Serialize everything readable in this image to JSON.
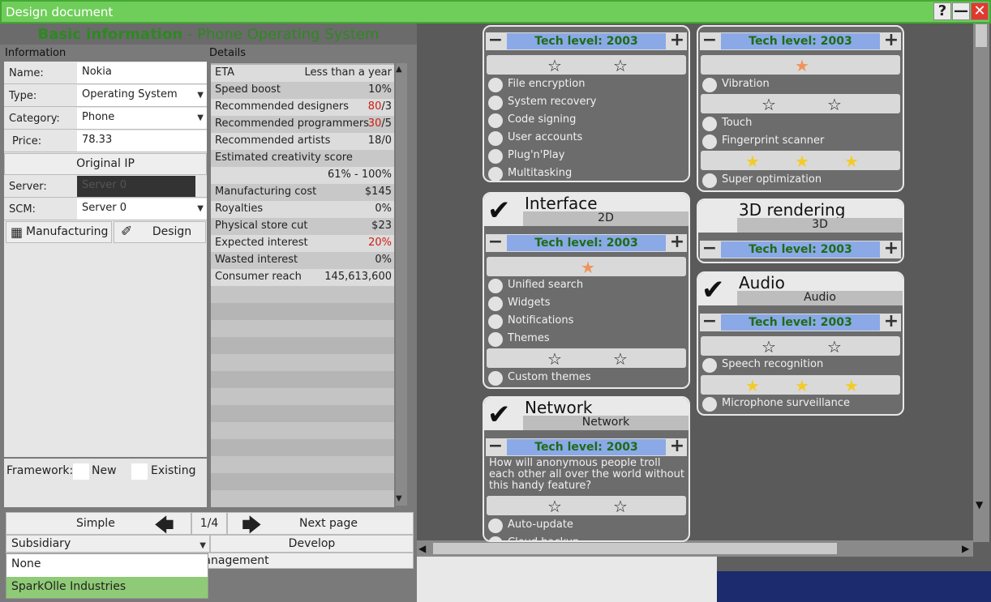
{
  "window": {
    "title": "Design document",
    "help": "?",
    "minimize": "—",
    "close": "✕"
  },
  "heading": {
    "main": "Basic information",
    "sep": " - ",
    "sub": "Phone Operating System"
  },
  "info": {
    "section": "Information",
    "name_label": "Name:",
    "name": "Nokia",
    "type_label": "Type:",
    "type": "Operating System",
    "category_label": "Category:",
    "category": "Phone",
    "price_label": "Price:",
    "price": "78.33",
    "original_ip": "Original IP",
    "server_label": "Server:",
    "server": "Server 0",
    "scm_label": "SCM:",
    "scm": "Server 0",
    "manufacturing": "Manufacturing",
    "design": "Design",
    "framework_label": "Framework:",
    "new": "New",
    "existing": "Existing"
  },
  "details": {
    "section": "Details",
    "rows": [
      {
        "label": "ETA",
        "value": "Less than a year"
      },
      {
        "label": "Speed boost",
        "value": "10%"
      },
      {
        "label": "Recommended designers",
        "value_red": "80",
        "value": "/3"
      },
      {
        "label": "Recommended programmers",
        "value_red": "30",
        "value": "/5"
      },
      {
        "label": "Recommended artists",
        "value": "18/0"
      },
      {
        "label": "Estimated creativity score",
        "value": ""
      },
      {
        "label": "",
        "value": "61% - 100%"
      },
      {
        "label": "Manufacturing cost",
        "value": "$145"
      },
      {
        "label": "Royalties",
        "value": "0%"
      },
      {
        "label": "Physical store cut",
        "value": "$23"
      },
      {
        "label": "Expected interest",
        "value_red": "20%",
        "value": ""
      },
      {
        "label": "Wasted interest",
        "value": "0%"
      },
      {
        "label": "Consumer reach",
        "value": "145,613,600"
      }
    ]
  },
  "bottom": {
    "simple": "Simple",
    "page": "1/4",
    "next": "Next page",
    "subsidiary": "Subsidiary",
    "develop": "Develop",
    "project_management": "Project management",
    "dropdown": [
      "None",
      "SparkOlle Industries"
    ]
  },
  "features": {
    "tech_label": "Tech level: 2003",
    "security": {
      "options": [
        "File encryption",
        "System recovery",
        "Code signing",
        "User accounts",
        "Plug'n'Play",
        "Multitasking"
      ]
    },
    "interface": {
      "title": "Interface",
      "subtitle": "2D",
      "options": [
        "Unified search",
        "Widgets",
        "Notifications",
        "Themes"
      ],
      "options2": [
        "Custom themes"
      ]
    },
    "network": {
      "title": "Network",
      "subtitle": "Network",
      "description": "How will anonymous people troll each other all over the world without this handy feature?",
      "options": [
        "Auto-update",
        "Cloud backup"
      ]
    },
    "vibration": {
      "options": [
        "Vibration"
      ],
      "options2": [
        "Touch",
        "Fingerprint scanner"
      ],
      "options3": [
        "Super optimization"
      ]
    },
    "rendering": {
      "title": "3D rendering",
      "subtitle": "3D"
    },
    "audio": {
      "title": "Audio",
      "subtitle": "Audio",
      "options": [
        "Speech recognition"
      ],
      "options2": [
        "Microphone surveillance"
      ]
    }
  }
}
